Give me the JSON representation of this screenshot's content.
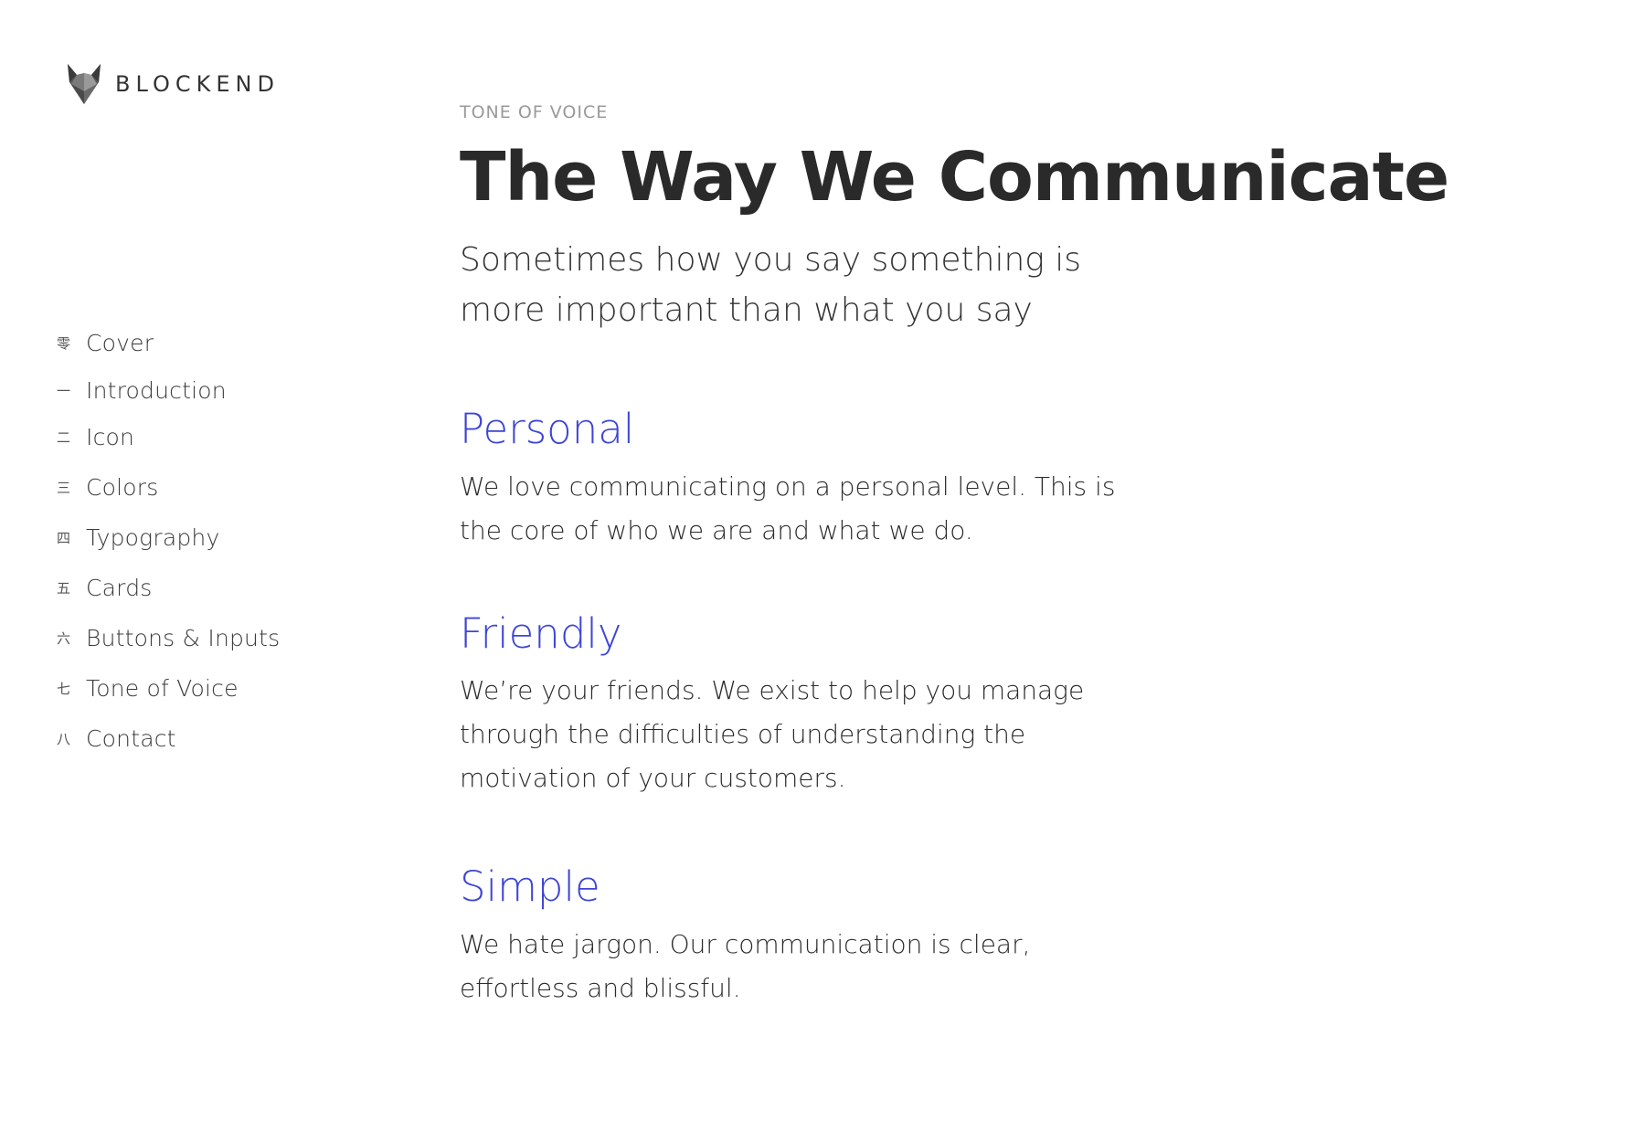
{
  "brand": {
    "name": "BLOCKEND",
    "logo_icon": "fox-head-icon"
  },
  "sidebar": {
    "items": [
      {
        "numeral": "零",
        "label": "Cover"
      },
      {
        "numeral": "一",
        "label": "Introduction"
      },
      {
        "numeral": "二",
        "label": "Icon"
      },
      {
        "numeral": "三",
        "label": "Colors"
      },
      {
        "numeral": "四",
        "label": "Typography"
      },
      {
        "numeral": "五",
        "label": "Cards"
      },
      {
        "numeral": "六",
        "label": "Buttons & Inputs"
      },
      {
        "numeral": "七",
        "label": "Tone of Voice"
      },
      {
        "numeral": "八",
        "label": "Contact"
      }
    ]
  },
  "main": {
    "eyebrow": "TONE OF VOICE",
    "title": "The Way We Communicate",
    "subtitle": "Sometimes how you say something is more important than what you say",
    "sections": [
      {
        "heading": "Personal",
        "body": "We love communicating on a personal level. This is the core of who we are and what we do."
      },
      {
        "heading": "Friendly",
        "body": "We’re your friends. We exist to help you manage through the difficulties of understanding the motivation of your customers."
      },
      {
        "heading": "Simple",
        "body": "We hate jargon. Our communication is clear, effortless and blissful."
      }
    ]
  },
  "colors": {
    "accent": "#3d45d6",
    "text": "#2b2b2b",
    "muted": "#9a9a9a"
  }
}
